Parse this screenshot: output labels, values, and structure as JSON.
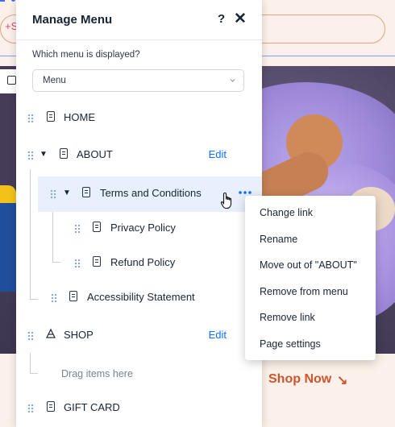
{
  "panel": {
    "title": "Manage Menu",
    "help_label": "?",
    "close_label": "✕",
    "which_menu_label": "Which menu is displayed?",
    "menu_select_value": "Menu"
  },
  "menu_items": [
    {
      "label": "HOME",
      "icon": "page-icon"
    },
    {
      "label": "ABOUT",
      "icon": "page-icon",
      "expanded": true,
      "edit_label": "Edit"
    },
    {
      "label": "Terms and Conditions",
      "icon": "page-icon",
      "expanded": true,
      "selected": true
    },
    {
      "label": "Privacy Policy",
      "icon": "page-icon"
    },
    {
      "label": "Refund Policy",
      "icon": "page-icon"
    },
    {
      "label": "Accessibility Statement",
      "icon": "page-icon"
    },
    {
      "label": "SHOP",
      "icon": "shop-icon",
      "edit_label": "Edit"
    },
    {
      "label": "GIFT CARD",
      "icon": "page-icon"
    }
  ],
  "drop_placeholder": "Drag items here",
  "context_menu": {
    "items": [
      "Change link",
      "Rename",
      "Move out of \"ABOUT\"",
      "Remove from menu",
      "Remove link",
      "Page settings"
    ]
  },
  "background_site": {
    "plus_text": "+S",
    "cta_label": "Shop Now",
    "cta_arrow": "↘",
    "accent_color": "#d0542a"
  },
  "colors": {
    "link_blue": "#116dff",
    "selected_row": "#e8f0fe"
  }
}
